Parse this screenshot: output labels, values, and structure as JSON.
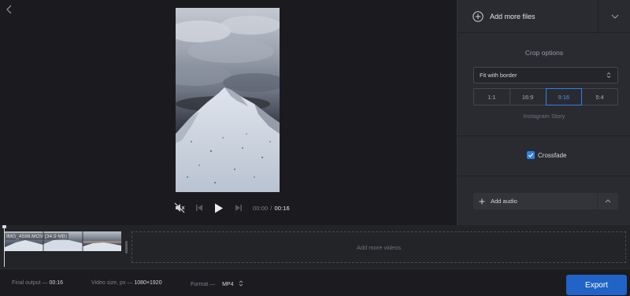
{
  "player": {
    "current_time": "00:00",
    "separator": "/",
    "duration": "00:16"
  },
  "panel": {
    "add_files_label": "Add more files",
    "crop_title": "Crop options",
    "crop_mode": "Fit with border",
    "ratios": [
      "1:1",
      "16:9",
      "9:16",
      "5:4"
    ],
    "active_ratio": "9:16",
    "ratio_caption": "Instagram Story",
    "crossfade_label": "Crossfade",
    "crossfade_checked": true,
    "add_audio_label": "Add audio"
  },
  "timeline": {
    "clip_name": "IMG_4598.MOV (34.9 MB)",
    "add_videos_label": "Add more videos"
  },
  "bottom": {
    "final_output_label": "Final output —",
    "final_output_value": "00:16",
    "video_size_label": "Video size, px —",
    "video_size_value": "1080×1920",
    "format_label": "Format —",
    "format_value": "MP4",
    "export_label": "Export"
  },
  "colors": {
    "accent": "#2f7fe8",
    "export": "#2163c7",
    "panel_bg": "#2a2b30",
    "app_bg": "#1c1c20"
  },
  "icons": {
    "back": "chevron-left-icon",
    "mute": "speaker-muted-icon",
    "prev": "skip-previous-icon",
    "play": "play-icon",
    "next": "skip-next-icon",
    "add_files": "plus-circle-icon",
    "expand": "chevron-down-icon",
    "select": "up-down-caret-icon",
    "check": "check-icon",
    "add_audio": "plus-icon",
    "collapse": "chevron-up-icon"
  }
}
